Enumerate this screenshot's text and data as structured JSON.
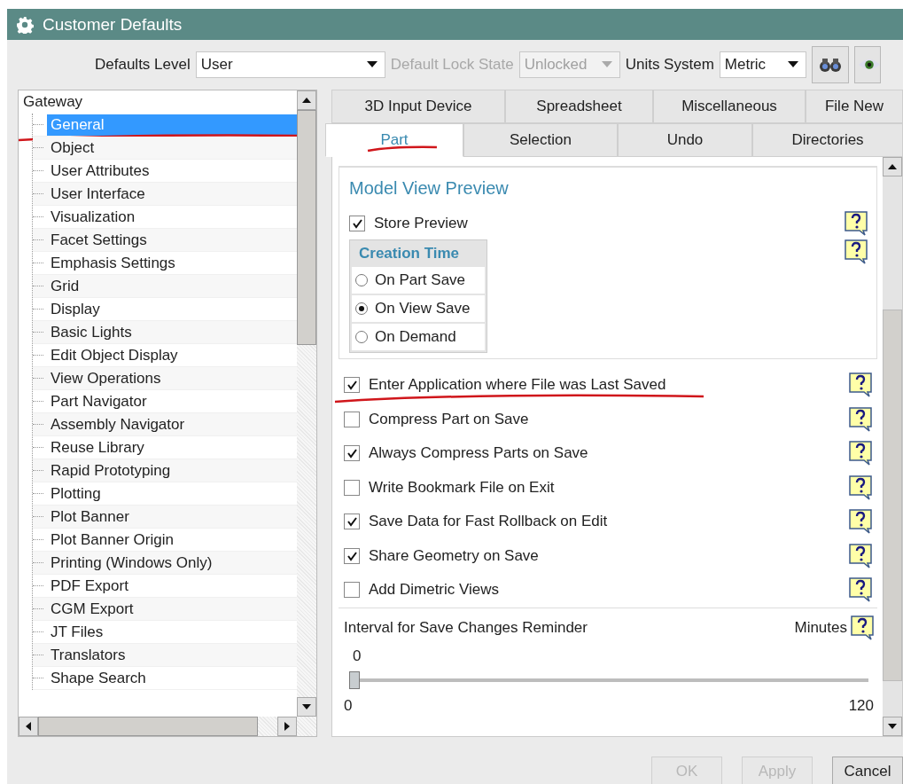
{
  "window": {
    "title": "Customer Defaults"
  },
  "toolbar": {
    "defaults_level": {
      "label": "Defaults Level",
      "value": "User"
    },
    "lock_state": {
      "label": "Default Lock State",
      "value": "Unlocked",
      "disabled": true
    },
    "units_system": {
      "label": "Units System",
      "value": "Metric"
    }
  },
  "tree": {
    "label": "Gateway",
    "children": [
      {
        "label": "General",
        "selected": true,
        "marked": true
      },
      {
        "label": "Object",
        "selected": false,
        "marked": false
      },
      {
        "label": "User Attributes",
        "selected": false,
        "marked": false
      },
      {
        "label": "User Interface",
        "selected": false,
        "marked": false
      },
      {
        "label": "Visualization",
        "selected": false,
        "marked": false
      },
      {
        "label": "Facet Settings",
        "selected": false,
        "marked": false
      },
      {
        "label": "Emphasis Settings",
        "selected": false,
        "marked": false
      },
      {
        "label": "Grid",
        "selected": false,
        "marked": false
      },
      {
        "label": "Display",
        "selected": false,
        "marked": false
      },
      {
        "label": "Basic Lights",
        "selected": false,
        "marked": false
      },
      {
        "label": "Edit Object Display",
        "selected": false,
        "marked": false
      },
      {
        "label": "View Operations",
        "selected": false,
        "marked": false
      },
      {
        "label": "Part Navigator",
        "selected": false,
        "marked": false
      },
      {
        "label": "Assembly Navigator",
        "selected": false,
        "marked": false
      },
      {
        "label": "Reuse Library",
        "selected": false,
        "marked": false
      },
      {
        "label": "Rapid Prototyping",
        "selected": false,
        "marked": false
      },
      {
        "label": "Plotting",
        "selected": false,
        "marked": false
      },
      {
        "label": "Plot Banner",
        "selected": false,
        "marked": false
      },
      {
        "label": "Plot Banner Origin",
        "selected": false,
        "marked": false
      },
      {
        "label": "Printing (Windows Only)",
        "selected": false,
        "marked": false
      },
      {
        "label": "PDF Export",
        "selected": false,
        "marked": false
      },
      {
        "label": "CGM Export",
        "selected": false,
        "marked": false
      },
      {
        "label": "JT Files",
        "selected": false,
        "marked": false
      },
      {
        "label": "Translators",
        "selected": false,
        "marked": false
      },
      {
        "label": "Shape Search",
        "selected": false,
        "marked": false
      }
    ]
  },
  "tabs": {
    "row_1": [
      {
        "label": "3D Input Device",
        "selected": false,
        "marked": false
      },
      {
        "label": "Spreadsheet",
        "selected": false,
        "marked": false
      },
      {
        "label": "Miscellaneous",
        "selected": false,
        "marked": false
      },
      {
        "label": "File New",
        "selected": false,
        "marked": false
      }
    ],
    "row_2": [
      {
        "label": "Part",
        "selected": true,
        "marked": true
      },
      {
        "label": "Selection",
        "selected": false,
        "marked": false
      },
      {
        "label": "Undo",
        "selected": false,
        "marked": false
      },
      {
        "label": "Directories",
        "selected": false,
        "marked": false
      }
    ]
  },
  "panel": {
    "group": {
      "title": "Model View Preview",
      "store_preview": {
        "label": "Store Preview",
        "checked": true
      },
      "creation_time": {
        "title": "Creation Time",
        "options": [
          {
            "label": "On Part Save",
            "selected": false
          },
          {
            "label": "On View Save",
            "selected": true
          },
          {
            "label": "On Demand",
            "selected": false
          }
        ]
      }
    },
    "options": [
      {
        "label": "Enter Application where File was Last Saved",
        "checked": true,
        "marked": true
      },
      {
        "label": "Compress Part on Save",
        "checked": false,
        "marked": false
      },
      {
        "label": "Always Compress Parts on Save",
        "checked": true,
        "marked": false
      },
      {
        "label": "Write Bookmark File on Exit",
        "checked": false,
        "marked": false
      },
      {
        "label": "Save Data for Fast Rollback on Edit",
        "checked": true,
        "marked": false
      },
      {
        "label": "Share Geometry on Save",
        "checked": true,
        "marked": false
      },
      {
        "label": "Add Dimetric Views",
        "checked": false,
        "marked": false
      }
    ],
    "interval": {
      "label": "Interval for Save Changes Reminder",
      "unit": "Minutes",
      "value": "0",
      "level": 0,
      "min": "0",
      "max": "120"
    }
  },
  "buttons": [
    {
      "label": "OK",
      "disabled": true
    },
    {
      "label": "Apply",
      "disabled": true
    },
    {
      "label": "Cancel",
      "disabled": false
    }
  ]
}
